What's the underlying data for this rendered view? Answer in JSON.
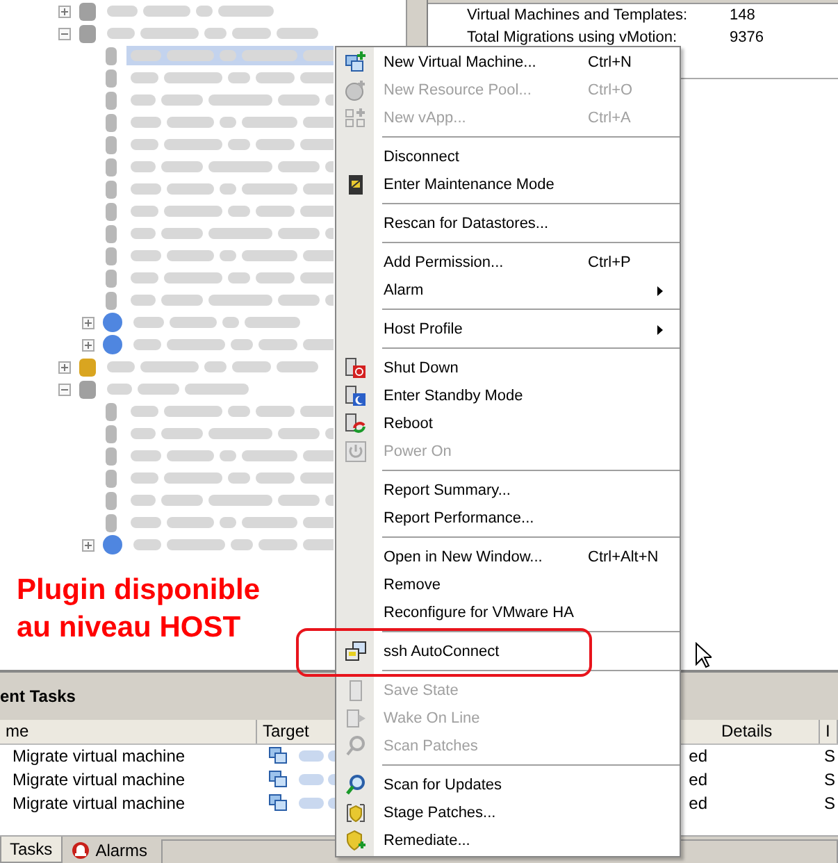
{
  "tree": {
    "items": [
      {
        "kind": "cluster",
        "expanded": false
      },
      {
        "kind": "cluster",
        "expanded": true,
        "children": [
          {
            "kind": "host",
            "selected": true
          },
          {
            "kind": "host",
            "selected": false
          },
          {
            "kind": "host",
            "selected": false
          },
          {
            "kind": "host",
            "selected": false
          },
          {
            "kind": "host",
            "selected": false
          },
          {
            "kind": "host",
            "selected": false
          },
          {
            "kind": "host",
            "selected": false
          },
          {
            "kind": "host",
            "selected": false
          },
          {
            "kind": "host",
            "selected": false
          },
          {
            "kind": "host",
            "selected": false
          },
          {
            "kind": "host",
            "selected": false
          },
          {
            "kind": "host",
            "selected": false
          },
          {
            "kind": "pool",
            "expanded": false
          },
          {
            "kind": "pool",
            "expanded": false
          }
        ]
      },
      {
        "kind": "cluster-alert",
        "expanded": false
      },
      {
        "kind": "cluster",
        "expanded": true,
        "children": [
          {
            "kind": "host",
            "selected": false
          },
          {
            "kind": "host",
            "selected": false
          },
          {
            "kind": "host",
            "selected": false
          },
          {
            "kind": "host",
            "selected": false
          },
          {
            "kind": "host",
            "selected": false
          },
          {
            "kind": "host",
            "selected": false
          },
          {
            "kind": "pool",
            "expanded": false
          }
        ]
      }
    ]
  },
  "summary": [
    {
      "label": "Virtual Machines and Templates:",
      "value": "148"
    },
    {
      "label": "Total Migrations using vMotion:",
      "value": "9376"
    }
  ],
  "context_menu": {
    "items": [
      {
        "kind": "item",
        "label": "New Virtual Machine...",
        "shortcut": "Ctrl+N",
        "disabled": false
      },
      {
        "kind": "item",
        "label": "New Resource Pool...",
        "shortcut": "Ctrl+O",
        "disabled": true
      },
      {
        "kind": "item",
        "label": "New vApp...",
        "shortcut": "Ctrl+A",
        "disabled": true
      },
      {
        "kind": "separator"
      },
      {
        "kind": "item",
        "label": "Disconnect",
        "disabled": false
      },
      {
        "kind": "item",
        "label": "Enter Maintenance Mode",
        "disabled": false
      },
      {
        "kind": "separator"
      },
      {
        "kind": "item",
        "label": "Rescan for Datastores...",
        "disabled": false
      },
      {
        "kind": "separator"
      },
      {
        "kind": "item",
        "label": "Add Permission...",
        "shortcut": "Ctrl+P",
        "disabled": false
      },
      {
        "kind": "item",
        "label": "Alarm",
        "submenu": true,
        "disabled": false
      },
      {
        "kind": "separator"
      },
      {
        "kind": "item",
        "label": "Host Profile",
        "submenu": true,
        "disabled": false
      },
      {
        "kind": "separator"
      },
      {
        "kind": "item",
        "label": "Shut Down",
        "disabled": false
      },
      {
        "kind": "item",
        "label": "Enter Standby Mode",
        "disabled": false
      },
      {
        "kind": "item",
        "label": "Reboot",
        "disabled": false
      },
      {
        "kind": "item",
        "label": "Power On",
        "disabled": true
      },
      {
        "kind": "separator"
      },
      {
        "kind": "item",
        "label": "Report Summary...",
        "disabled": false
      },
      {
        "kind": "item",
        "label": "Report Performance...",
        "disabled": false
      },
      {
        "kind": "separator"
      },
      {
        "kind": "item",
        "label": "Open in New Window...",
        "shortcut": "Ctrl+Alt+N",
        "disabled": false
      },
      {
        "kind": "item",
        "label": "Remove",
        "disabled": false
      },
      {
        "kind": "item",
        "label": "Reconfigure for VMware HA",
        "disabled": false
      },
      {
        "kind": "separator"
      },
      {
        "kind": "item",
        "label": "ssh AutoConnect",
        "disabled": false,
        "highlighted": true
      },
      {
        "kind": "separator"
      },
      {
        "kind": "item",
        "label": "Save State",
        "disabled": true
      },
      {
        "kind": "item",
        "label": "Wake On Line",
        "disabled": true
      },
      {
        "kind": "item",
        "label": "Scan Patches",
        "disabled": true
      },
      {
        "kind": "separator"
      },
      {
        "kind": "item",
        "label": "Scan for Updates",
        "disabled": false
      },
      {
        "kind": "item",
        "label": "Stage Patches...",
        "disabled": false
      },
      {
        "kind": "item",
        "label": "Remediate...",
        "disabled": false
      }
    ]
  },
  "annotation": {
    "lines": [
      "Plugin disponible",
      "au niveau HOST"
    ]
  },
  "recent_tasks": {
    "title": "ent Tasks",
    "columns": [
      {
        "label": "me"
      },
      {
        "label": "Target"
      },
      {
        "label": "Details"
      },
      {
        "label": "I"
      }
    ],
    "rows": [
      {
        "name": "Migrate virtual machine",
        "status": "ed",
        "column_5": "S"
      },
      {
        "name": "Migrate virtual machine",
        "status": "ed",
        "column_5": "S"
      },
      {
        "name": "Migrate virtual machine",
        "status": "ed",
        "column_5": "S"
      }
    ]
  },
  "status_bar": {
    "tabs": [
      {
        "label": "Tasks",
        "kind": "tasks",
        "selected": true
      },
      {
        "label": "Alarms",
        "kind": "alarms",
        "selected": false
      }
    ]
  }
}
